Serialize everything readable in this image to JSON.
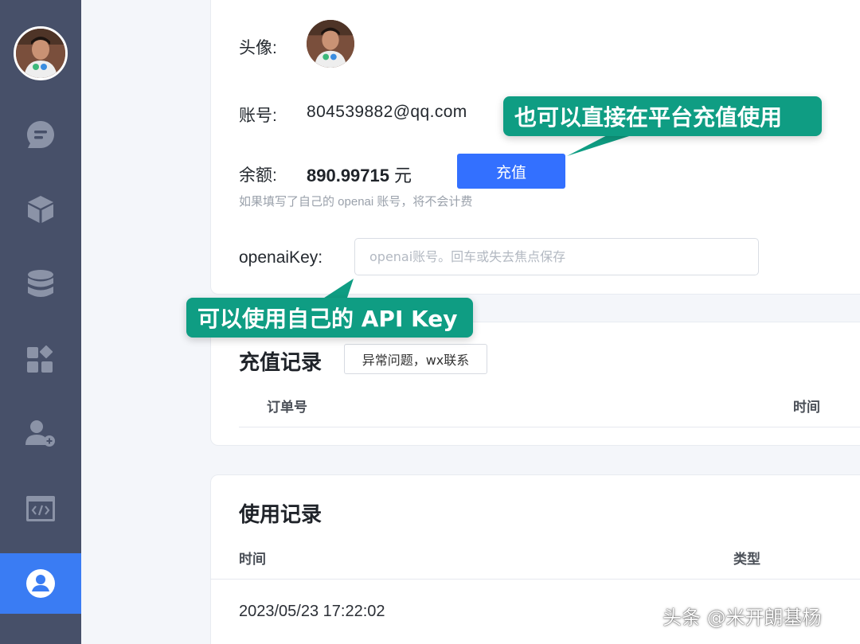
{
  "profile": {
    "avatar_label": "头像:",
    "account_label": "账号:",
    "account_value": "804539882@qq.com",
    "balance_label": "余额:",
    "balance_value": "890.99715",
    "balance_unit": "元",
    "recharge_button": "充值",
    "hint": "如果填写了自己的 openai 账号，将不会计费",
    "key_label": "openaiKey:",
    "key_placeholder": "openai账号。回车或失去焦点保存"
  },
  "recharge_records": {
    "title": "充值记录",
    "issue_button": "异常问题，wx联系",
    "columns": [
      "订单号",
      "时间"
    ]
  },
  "usage_records": {
    "title": "使用记录",
    "columns": [
      "时间",
      "类型"
    ],
    "rows": [
      {
        "time": "2023/05/23 17:22:02"
      }
    ]
  },
  "callouts": {
    "recharge": "也可以直接在平台充值使用",
    "api_key": "可以使用自己的 API Key"
  },
  "watermark": "头条 @米开朗基杨",
  "sidebar": {
    "icons": [
      "chat-icon",
      "cube-icon",
      "database-icon",
      "apps-icon",
      "user-add-icon",
      "code-icon",
      "user-icon"
    ],
    "active": "user-icon"
  },
  "colors": {
    "sidebar_bg": "#475069",
    "active_bg": "#3a7cf3",
    "primary_button": "#3370ff",
    "callout": "#0f9d83"
  }
}
